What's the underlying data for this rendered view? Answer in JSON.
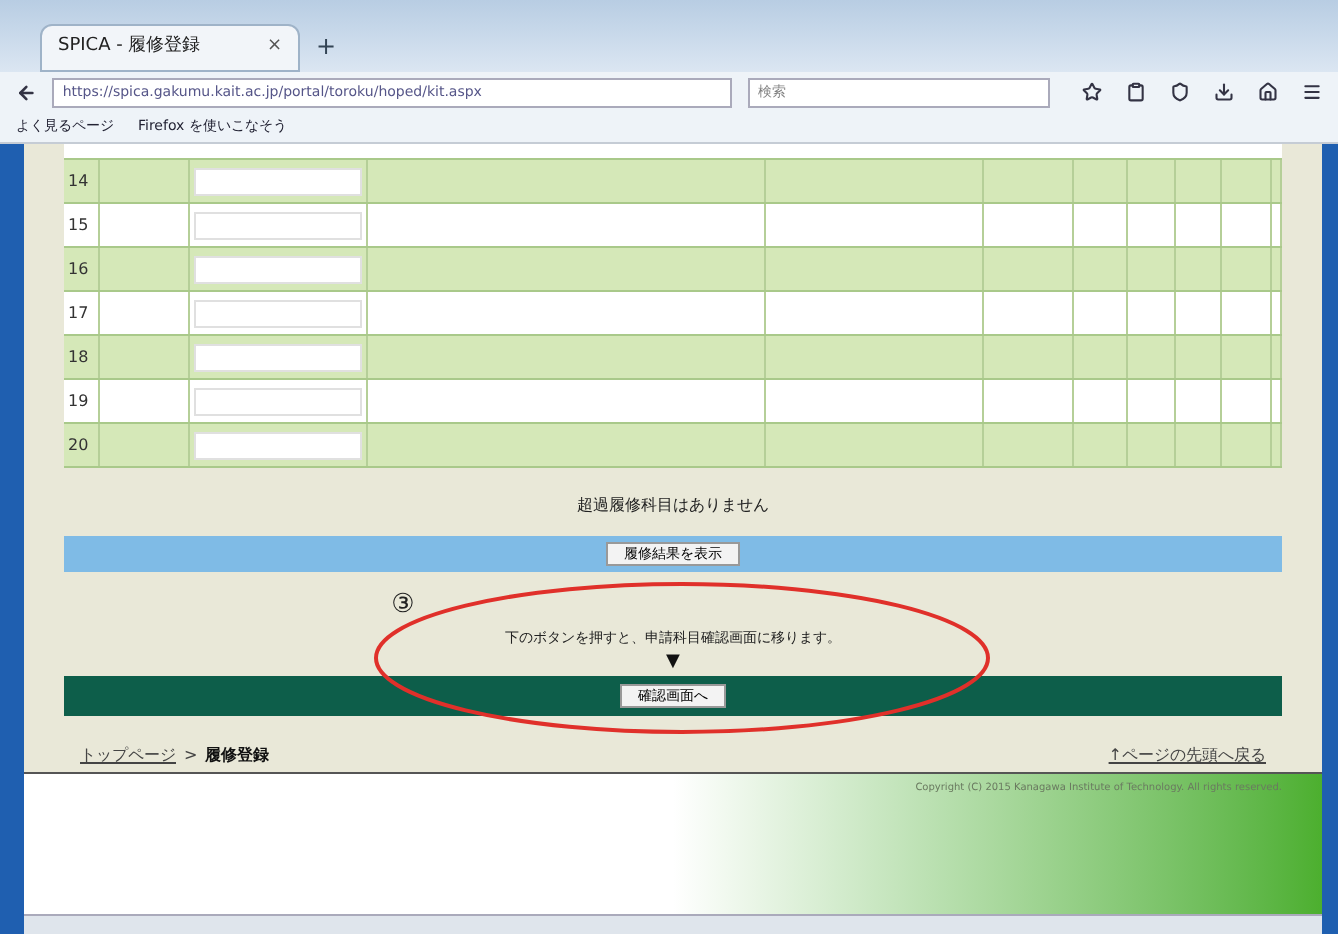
{
  "browser": {
    "tab_title": "SPICA - 履修登録",
    "tab_close": "×",
    "new_tab": "+",
    "address": "https://spica.gakumu.kait.ac.jp/portal/toroku/hoped/kit.aspx",
    "search_placeholder": "検索",
    "bookmarks": [
      "よく見るページ",
      "Firefox を使いこなそう"
    ]
  },
  "table": {
    "rows": [
      {
        "number": "14",
        "shaded": true
      },
      {
        "number": "15",
        "shaded": false
      },
      {
        "number": "16",
        "shaded": true
      },
      {
        "number": "17",
        "shaded": false
      },
      {
        "number": "18",
        "shaded": true
      },
      {
        "number": "19",
        "shaded": false
      },
      {
        "number": "20",
        "shaded": true
      }
    ]
  },
  "notice": "超過履修科目はありません",
  "result_button": "履修結果を表示",
  "step_mark": "③",
  "instruction": "下のボタンを押すと、申請科目確認画面に移ります。",
  "arrow": "▼",
  "confirm_button": "確認画面へ",
  "breadcrumb": {
    "top": "トップページ",
    "separator": ">",
    "current": "履修登録"
  },
  "back_to_top": "↑ページの先頭へ戻る",
  "copyright": "Copyright (C) 2015 Kanagawa Institute of Technology. All rights reserved."
}
